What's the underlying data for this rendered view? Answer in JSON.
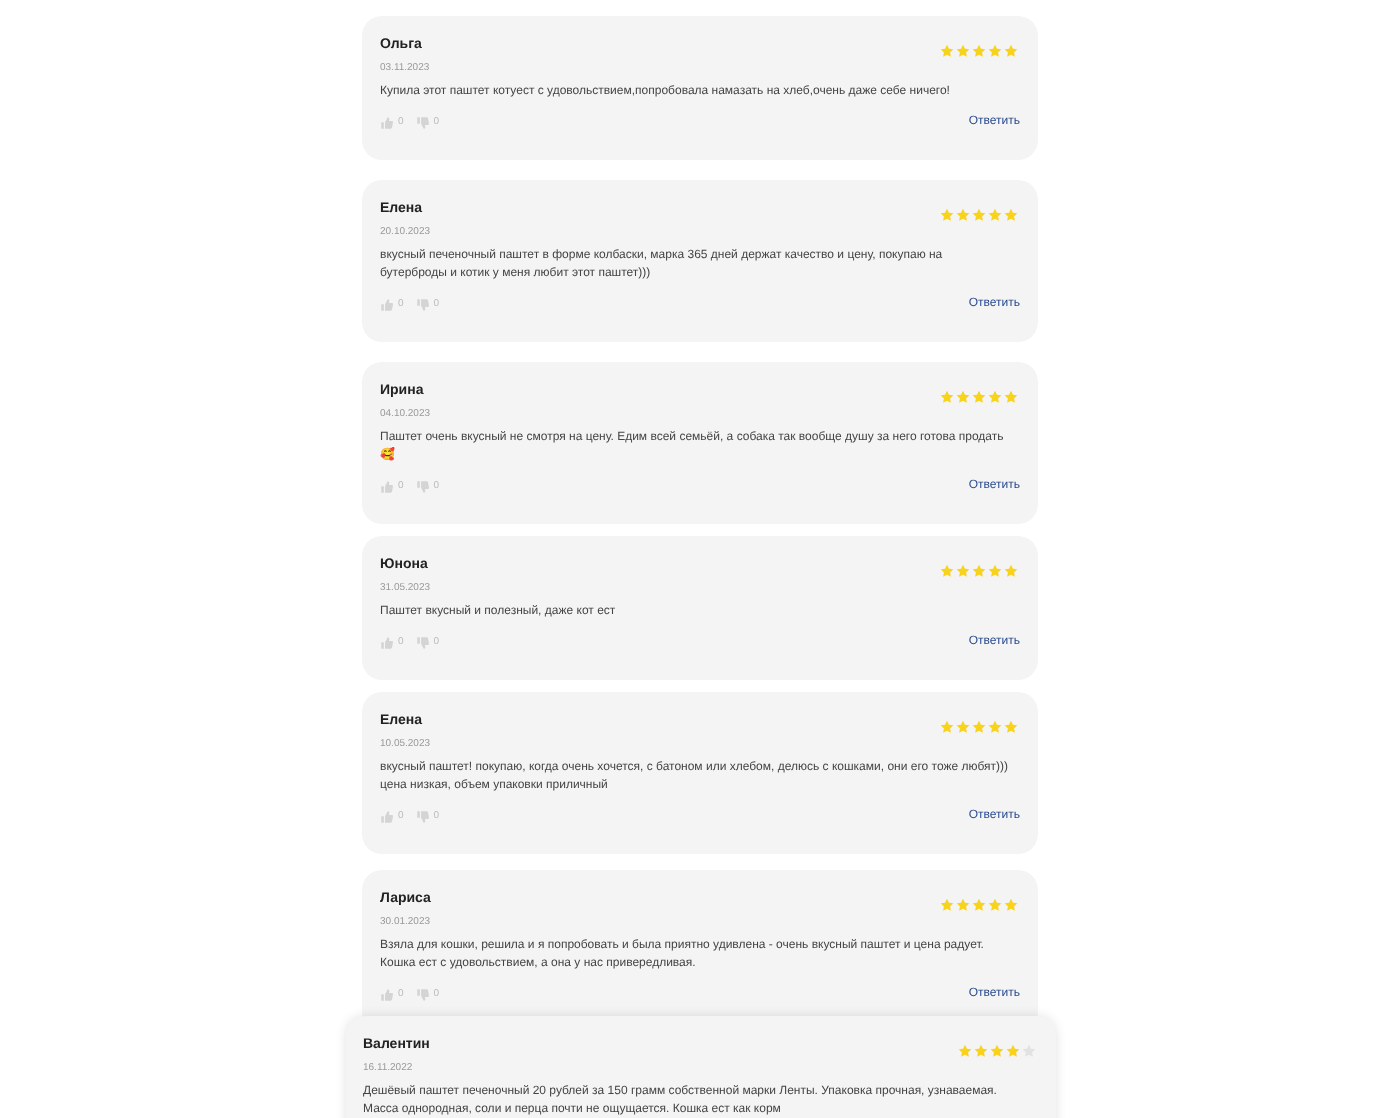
{
  "reviews": [
    {
      "author": "Ольга",
      "date": "03.11.2023",
      "stars": 5,
      "text": "Купила этот паштет котуест с удовольствием,попробовала намазать на хлеб,очень даже себе ничего!",
      "likes": "0",
      "dislikes": "0",
      "reply": "Ответить"
    },
    {
      "author": "Елена",
      "date": "20.10.2023",
      "stars": 5,
      "text": "вкусный печеночный паштет в форме колбаски, марка 365 дней держат качество и цену, покупаю на бутерброды и котик у меня любит этот паштет)))",
      "likes": "0",
      "dislikes": "0",
      "reply": "Ответить"
    },
    {
      "author": "Ирина",
      "date": "04.10.2023",
      "stars": 5,
      "text": "Паштет очень вкусный не смотря на цену. Едим всей семьёй, а собака так вообще душу за него готова продать 🥰",
      "likes": "0",
      "dislikes": "0",
      "reply": "Ответить"
    },
    {
      "author": "Юнона",
      "date": "31.05.2023",
      "stars": 5,
      "text": "Паштет вкусный и полезный, даже кот ест",
      "likes": "0",
      "dislikes": "0",
      "reply": "Ответить"
    },
    {
      "author": "Елена",
      "date": "10.05.2023",
      "stars": 5,
      "text": "вкусный паштет! покупаю, когда очень хочется, с батоном или хлебом, делюсь с кошками, они его тоже любят))) цена низкая, объем упаковки приличный",
      "likes": "0",
      "dislikes": "0",
      "reply": "Ответить"
    },
    {
      "author": "Лариса",
      "date": "30.01.2023",
      "stars": 5,
      "text": "Взяла для кошки, решила и я попробовать и была приятно удивлена - очень вкусный паштет и цена радует. Кошка ест с удовольствием, а она у нас привередливая.",
      "likes": "0",
      "dislikes": "0",
      "reply": "Ответить"
    },
    {
      "author": "Валентин",
      "date": "16.11.2022",
      "stars": 4,
      "text": "Дешёвый паштет печеночный 20 рублей за 150 грамм собственной марки Ленты. Упаковка прочная, узнаваемая. Масса однородная, соли и перца почти не ощущается. Кошка ест как корм"
    }
  ]
}
